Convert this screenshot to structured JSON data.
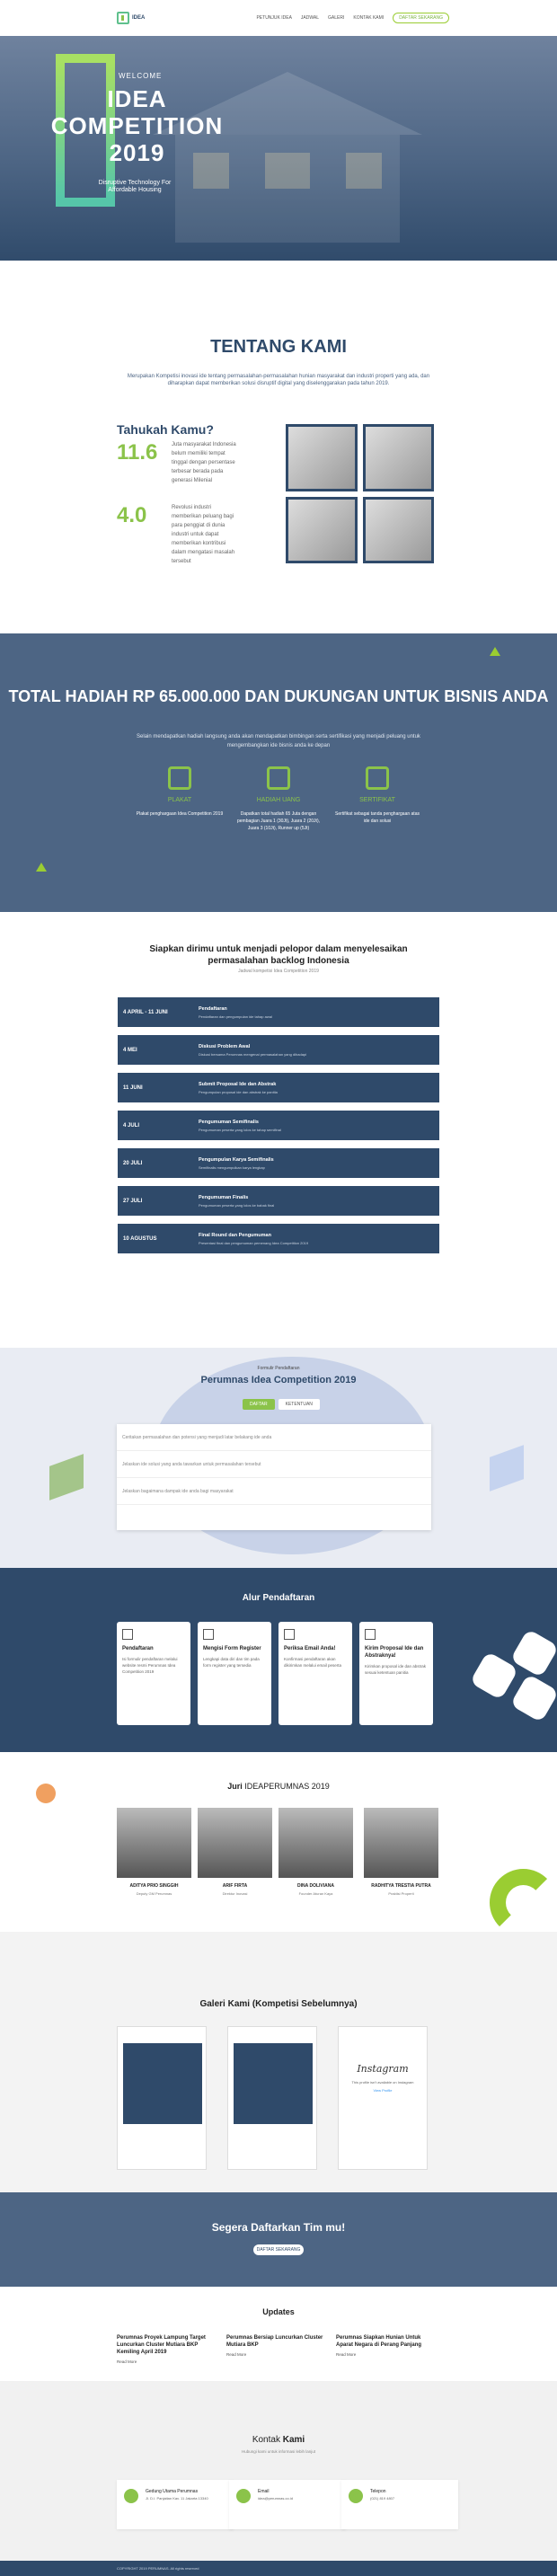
{
  "nav": {
    "logo_text": "IDEA",
    "items": [
      "PETUNJUK IDEA",
      "JADWAL",
      "GALERI",
      "KONTAK KAMI"
    ],
    "register": "DAFTAR SEKARANG"
  },
  "hero": {
    "welcome": "WELCOME",
    "title": "IDEA COMPETITION 2019",
    "tagline": "Disruptive Technology For Affordable Housing"
  },
  "about": {
    "title": "TENTANG KAMI",
    "desc": "Merupakan Kompetisi inovasi ide tentang permasalahan-permasalahan hunian masyarakat dan industri properti yang ada, dan diharapkan dapat memberikan solusi disruptif digital yang diselenggarakan pada tahun 2019.",
    "tahukah": "Tahukah Kamu?",
    "stats": [
      {
        "num": "11.6",
        "text": "Juta masyarakat Indonesia belum memiliki tempat tinggal dengan persentase terbesar berada pada generasi Milenial"
      },
      {
        "num": "4.0",
        "text": "Revolusi industri memberikan peluang bagi para penggiat di dunia industri untuk dapat memberikan kontribusi dalam mengatasi masalah tersebut"
      }
    ]
  },
  "prize": {
    "title": "TOTAL HADIAH RP 65.000.000 DAN DUKUNGAN UNTUK BISNIS ANDA",
    "desc": "Selain mendapatkan hadiah langsung anda akan mendapatkan bimbingan serta sertifikasi yang menjadi peluang untuk mengembangkan ide bisnis anda ke depan",
    "items": [
      {
        "title": "PLAKAT",
        "desc": "Plakat penghargaan Idea Competition 2019"
      },
      {
        "title": "HADIAH UANG",
        "desc": "Dapatkan total hadiah 65 Juta dengan pembagian Juara 1 (30Jt), Juara 2 (20Jt), Juara 3 (10Jt), Runner up (5Jt)"
      },
      {
        "title": "SERTIFIKAT",
        "desc": "Sertifikat sebagai tanda penghargaan atas ide dan solusi"
      }
    ]
  },
  "timeline": {
    "title": "Siapkan dirimu untuk menjadi pelopor dalam menyelesaikan permasalahan backlog Indonesia",
    "subtitle": "Jadwal kompetisi Idea Competition 2019",
    "rows": [
      {
        "date": "4 APRIL - 11 JUNI",
        "name": "Pendaftaran",
        "desc": "Pendaftaran dan pengumpulan ide tahap awal"
      },
      {
        "date": "4 MEI",
        "name": "Diskusi Problem Awal",
        "desc": "Diskusi bersama Perumnas mengenai permasalahan yang dihadapi"
      },
      {
        "date": "11 JUNI",
        "name": "Submit Proposal Ide dan Abstrak",
        "desc": "Pengumpulan proposal ide dan abstrak ke panitia"
      },
      {
        "date": "4 JULI",
        "name": "Pengumuman Semifinalis",
        "desc": "Pengumuman peserta yang lolos ke tahap semifinal"
      },
      {
        "date": "20 JULI",
        "name": "Pengumpulan Karya Semifinalis",
        "desc": "Semifinalis mengumpulkan karya lengkap"
      },
      {
        "date": "27 JULI",
        "name": "Pengumuman Finalis",
        "desc": "Pengumuman peserta yang lolos ke babak final"
      },
      {
        "date": "10 AGUSTUS",
        "name": "Final Round dan Pengumuman",
        "desc": "Presentasi final dan pengumuman pemenang Idea Competition 2019"
      }
    ]
  },
  "form": {
    "label": "Formulir Pendaftaran",
    "title": "Perumnas Idea Competition 2019",
    "tabs": [
      "DAFTAR",
      "KETENTUAN"
    ],
    "questions": [
      "Ceritakan permasalahan dan potensi yang menjadi latar belakang ide anda",
      "Jelaskan ide solusi yang anda tawarkan untuk permasalahan tersebut",
      "Jelaskan bagaimana dampak ide anda bagi masyarakat"
    ]
  },
  "alur": {
    "title": "Alur Pendaftaran",
    "steps": [
      {
        "title": "Pendaftaran",
        "desc": "Isi formulir pendaftaran melalui website resmi Perumnas Idea Competition 2019"
      },
      {
        "title": "Mengisi Form Register",
        "desc": "Lengkapi data diri dan tim pada form register yang tersedia"
      },
      {
        "title": "Periksa Email Anda!",
        "desc": "Konfirmasi pendaftaran akan dikirimkan melalui email peserta"
      },
      {
        "title": "Kirim Proposal Ide dan Abstraknya!",
        "desc": "Kirimkan proposal ide dan abstrak sesuai ketentuan panitia"
      }
    ]
  },
  "juri": {
    "title_a": "Juri",
    "title_b": " IDEAPERUMNAS 2019",
    "members": [
      {
        "name": "ADITYA PRIO SINGGIH",
        "role": "Deputy GM Perumnas"
      },
      {
        "name": "ARIF FIRTA",
        "role": "Direktur Inovasi"
      },
      {
        "name": "DINA DOLIVIANA",
        "role": "Founder Aturan Kaya"
      },
      {
        "name": "RADHITYA TRESTIA PUTRA",
        "role": "Praktisi Properti"
      }
    ]
  },
  "galeri": {
    "title_a": "Galeri",
    "title_b": " Kami (Kompetisi Sebelumnya)",
    "instagram": "Instagram",
    "ig_note": "This profile isn't available on Instagram",
    "view": "View Profile"
  },
  "cta": {
    "title": "Segera Daftarkan Tim mu!",
    "button": "DAFTAR SEKARANG"
  },
  "updates": {
    "title": "Updates",
    "items": [
      {
        "title": "Perumnas Proyek Lampung Target Luncurkan Cluster Mutiara BKP Kemiling April 2019",
        "more": "Read More"
      },
      {
        "title": "Perumnas Bersiap Luncurkan Cluster Mutiara BKP",
        "more": "Read More"
      },
      {
        "title": "Perumnas Siapkan Hunian Untuk Aparat Negara di Perang Panjang",
        "more": "Read More"
      }
    ]
  },
  "kontak": {
    "title_a": "Kontak",
    "title_b": " Kami",
    "sub": "Hubungi kami untuk informasi lebih lanjut",
    "cards": [
      {
        "title": "Gedung Utama Perumnas",
        "desc": "Jl. D.I. Panjaitan Kav. 11 Jakarta 13340"
      },
      {
        "title": "Email",
        "desc": "idea@perumnas.co.id"
      },
      {
        "title": "Telepon",
        "desc": "(021) 819 4807"
      }
    ]
  },
  "footer": "COPYRIGHT 2019 PERUMNAS. All rights reserved"
}
